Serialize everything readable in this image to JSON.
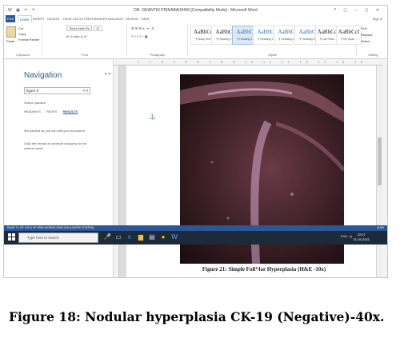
{
  "window": {
    "title": "DR. GRANTHI PRINABAISHMI [Compatibility Mode] - Microsoft Word",
    "controls": "?  ▢  –  ▢  ✕"
  },
  "ribbon_tabs": [
    "FILE",
    "HOME",
    "INSERT",
    "DESIGN",
    "PAGE LAYOUT",
    "REFERENCES",
    "MAILINGS",
    "REVIEW",
    "VIEW"
  ],
  "active_tab": "HOME",
  "sign_in": "Sign in",
  "clipboard": {
    "paste": "Paste",
    "cut": "Cut",
    "copy": "Copy",
    "format_painter": "Format Painter",
    "label": "Clipboard"
  },
  "font": {
    "name": "Times New Ro",
    "size": "12",
    "label": "Font",
    "formatting": "B  I  U  abc  x₂  x²"
  },
  "paragraph": {
    "label": "Paragraph"
  },
  "styles": {
    "label": "Styles",
    "items": [
      {
        "preview": "AaBbCc",
        "name": "¶ Body Text"
      },
      {
        "preview": "AaBbC",
        "name": "¶ Heading 1"
      },
      {
        "preview": "AaBbC",
        "name": "¶ Heading 2"
      },
      {
        "preview": "AaBbC",
        "name": "¶ Heading 3"
      },
      {
        "preview": "AaBbC",
        "name": "¶ Heading 4"
      },
      {
        "preview": "AaBbC",
        "name": "¶ Heading 5"
      },
      {
        "preview": "AaBbCcI",
        "name": "¶ List Para..."
      },
      {
        "preview": "AaBbCcI",
        "name": "¶ No Spac..."
      }
    ]
  },
  "editing": {
    "find": "Find",
    "replace": "Replace",
    "select": "Select",
    "label": "Editing"
  },
  "navigation": {
    "title": "Navigation",
    "search_value": "figure 9",
    "status": "Search paused",
    "tabs": [
      "HEADINGS",
      "PAGES",
      "RESULTS"
    ],
    "message1": "We paused as you can edit your document.",
    "message2": "Click the arrows to continue and jump to the closest result."
  },
  "document": {
    "caption": "Figure 21: Simple Foll¹ʸlar Hyperplasia (H&E -10x)"
  },
  "statusbar": {
    "left": "PAGE 71 OF 100     6 OF 8990 WORDS     ENGLISH (UNITED STATES)",
    "zoom": "119%"
  },
  "taskbar": {
    "search_placeholder": "Type here to search",
    "time": "22:07",
    "date": "21-03-2021",
    "tray": "ENG  ◁)"
  },
  "figure_caption": "Figure 18: Nodular hyperplasia CK-19 (Negative)-40x."
}
